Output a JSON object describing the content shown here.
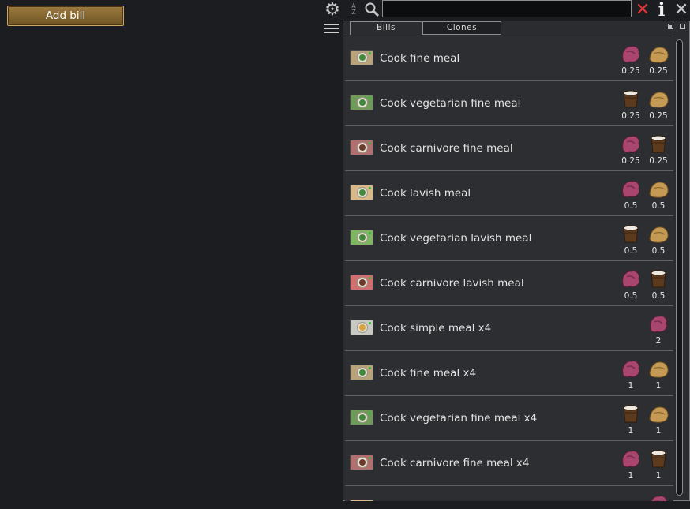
{
  "add_bill_label": "Add bill",
  "toolbar": {
    "sort_top": "A",
    "sort_bottom": "Z",
    "search_value": "",
    "clear_glyph": "✕",
    "info_glyph": "i",
    "close_glyph": "✕"
  },
  "tabs": [
    {
      "label": "Bills",
      "active": true
    },
    {
      "label": "Clones",
      "active": false
    }
  ],
  "colors": {
    "meat": "#a9466f",
    "veg": "#c49a55",
    "milk": "#eeeae2",
    "plate_fine": "#b9a37a",
    "plate_vegetarian": "#6f9a5a",
    "plate_carnivore": "#b17070",
    "plate_lavish": "#d9b98a",
    "plate_veg_lavish": "#7fb664",
    "plate_carn_lavish": "#cf6f6f",
    "plate_simple": "#c9c9c3"
  },
  "recipes": [
    {
      "label": "Cook fine meal",
      "plate": "plate_fine",
      "food": "#3f8a3a",
      "ingredients": [
        {
          "icon": "meat-icon",
          "qty": "0.25"
        },
        {
          "icon": "vegetable-icon",
          "qty": "0.25"
        }
      ]
    },
    {
      "label": "Cook vegetarian fine meal",
      "plate": "plate_vegetarian",
      "food": "#3f8a3a",
      "ingredients": [
        {
          "icon": "milk-icon",
          "qty": "0.25"
        },
        {
          "icon": "vegetable-icon",
          "qty": "0.25"
        }
      ]
    },
    {
      "label": "Cook carnivore fine meal",
      "plate": "plate_carnivore",
      "food": "#6b3a2a",
      "ingredients": [
        {
          "icon": "meat-icon",
          "qty": "0.25"
        },
        {
          "icon": "milk-icon",
          "qty": "0.25"
        }
      ]
    },
    {
      "label": "Cook lavish meal",
      "plate": "plate_lavish",
      "food": "#3f8a3a",
      "ingredients": [
        {
          "icon": "meat-icon",
          "qty": "0.5"
        },
        {
          "icon": "vegetable-icon",
          "qty": "0.5"
        }
      ]
    },
    {
      "label": "Cook vegetarian lavish meal",
      "plate": "plate_veg_lavish",
      "food": "#3f8a3a",
      "ingredients": [
        {
          "icon": "milk-icon",
          "qty": "0.5"
        },
        {
          "icon": "vegetable-icon",
          "qty": "0.5"
        }
      ]
    },
    {
      "label": "Cook carnivore lavish meal",
      "plate": "plate_carn_lavish",
      "food": "#6b3a2a",
      "ingredients": [
        {
          "icon": "meat-icon",
          "qty": "0.5"
        },
        {
          "icon": "milk-icon",
          "qty": "0.5"
        }
      ]
    },
    {
      "label": "Cook simple meal x4",
      "plate": "plate_simple",
      "food": "#d7a23a",
      "ingredients": [
        {
          "icon": "meat-icon",
          "qty": "2"
        }
      ]
    },
    {
      "label": "Cook fine meal x4",
      "plate": "plate_fine",
      "food": "#3f8a3a",
      "ingredients": [
        {
          "icon": "meat-icon",
          "qty": "1"
        },
        {
          "icon": "vegetable-icon",
          "qty": "1"
        }
      ]
    },
    {
      "label": "Cook vegetarian fine meal x4",
      "plate": "plate_vegetarian",
      "food": "#3f8a3a",
      "ingredients": [
        {
          "icon": "milk-icon",
          "qty": "1"
        },
        {
          "icon": "vegetable-icon",
          "qty": "1"
        }
      ]
    },
    {
      "label": "Cook carnivore fine meal x4",
      "plate": "plate_carnivore",
      "food": "#6b3a2a",
      "ingredients": [
        {
          "icon": "meat-icon",
          "qty": "1"
        },
        {
          "icon": "milk-icon",
          "qty": "1"
        }
      ]
    },
    {
      "label": "",
      "plate": "plate_lavish",
      "food": "#3f8a3a",
      "ingredients": [
        {
          "icon": "meat-icon",
          "qty": ""
        }
      ]
    }
  ]
}
